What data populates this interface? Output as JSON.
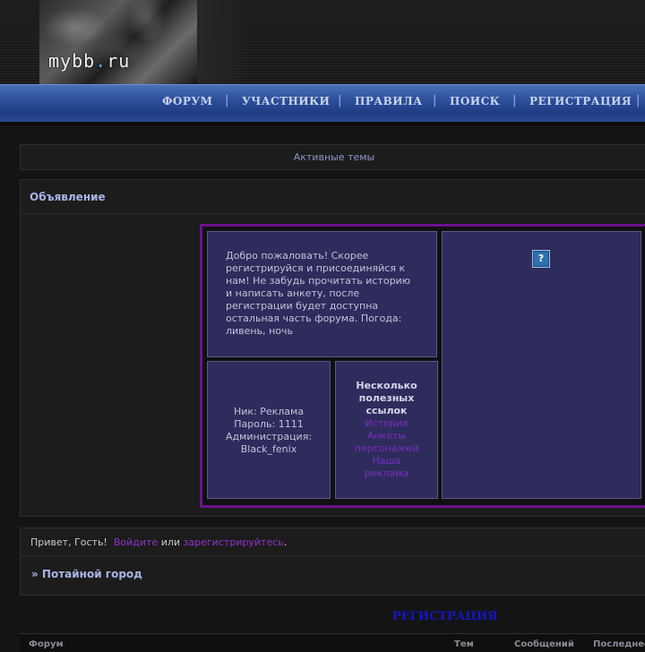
{
  "header": {
    "logo_text": "mybb",
    "logo_dot": ".",
    "logo_tld": "ru"
  },
  "nav": {
    "items": [
      "ФОРУМ",
      "УЧАСТНИКИ",
      "ПРАВИЛА",
      "ПОИСК",
      "РЕГИСТРАЦИЯ"
    ],
    "separator": "|"
  },
  "active_topics": "Активные темы",
  "announcement": {
    "title": "Объявление",
    "welcome_text": "Добро пожаловать! Скорее регистрируйся и присоединяйся к нам! Не забудь прочитать историю и написать анкету, после регистрации будет доступна остальная часть форума. Погода: ливень, ночь",
    "login_info": {
      "nick": "Ник: Реклама",
      "password": "Пароль: 1111",
      "admin_label": "Администрация:",
      "admin_name": "Black_fenix"
    },
    "links": {
      "title_line1": "Несколько",
      "title_line2": "полезных",
      "title_line3": "ссылок",
      "items": [
        "История",
        "Анкеты",
        "персонажей",
        "Наша",
        "реклама"
      ]
    },
    "image_icon": "broken-image-icon"
  },
  "greeting": {
    "prefix": "Привет, Гость!",
    "login_link": "Войдите",
    "or": "или",
    "register_link": "зарегистрируйтесь",
    "suffix": "."
  },
  "forum_crumb": "» Потайной город",
  "register_big": "РЕГИСТРАЦИЯ",
  "table_headers": {
    "forum": "Форум",
    "topics": "Тем",
    "posts": "Сообщений",
    "last": "Последнее"
  },
  "colors": {
    "accent_purple": "#6a128f",
    "link_purple": "#9333cc",
    "nav_blue": "#2d4f9a"
  }
}
